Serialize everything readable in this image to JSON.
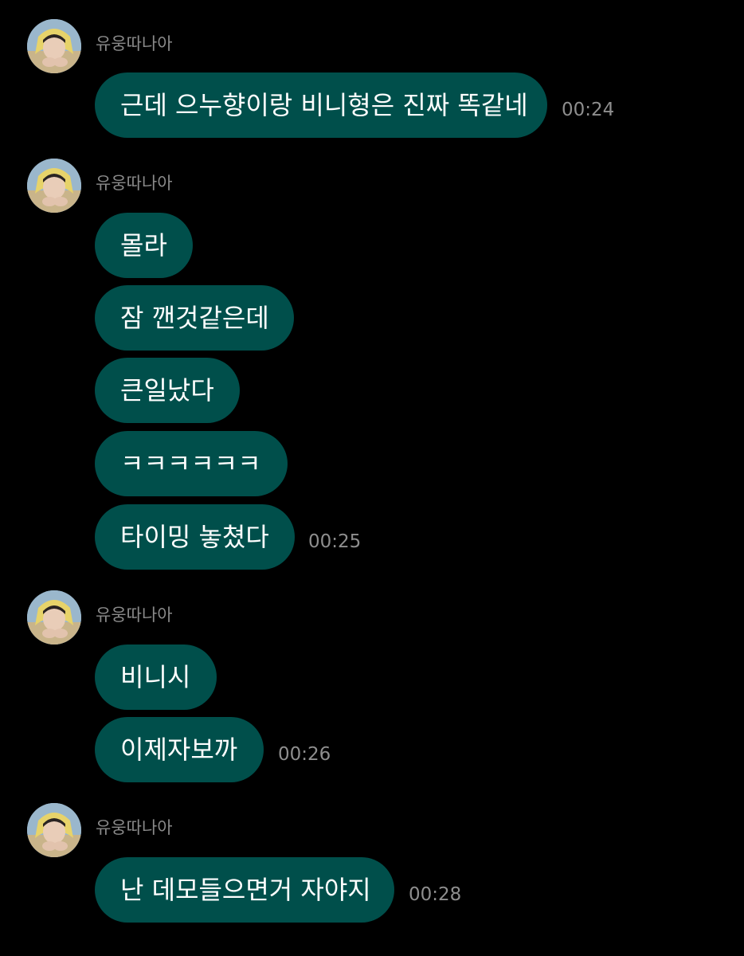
{
  "conversation": {
    "groups": [
      {
        "sender": "유웅따나아",
        "messages": [
          {
            "text": "근데 으누향이랑 비니형은 진짜 똑같네",
            "time": "00:24"
          }
        ]
      },
      {
        "sender": "유웅따나아",
        "messages": [
          {
            "text": "몰라",
            "time": ""
          },
          {
            "text": "잠 깬것같은데",
            "time": ""
          },
          {
            "text": "큰일났다",
            "time": ""
          },
          {
            "text": "ㅋㅋㅋㅋㅋㅋ",
            "time": ""
          },
          {
            "text": "타이밍 놓쳤다",
            "time": "00:25"
          }
        ]
      },
      {
        "sender": "유웅따나아",
        "messages": [
          {
            "text": "비니시",
            "time": ""
          },
          {
            "text": "이제자보까",
            "time": "00:26"
          }
        ]
      },
      {
        "sender": "유웅따나아",
        "messages": [
          {
            "text": "난 데모들으면거 자야지",
            "time": "00:28"
          }
        ]
      }
    ]
  },
  "colors": {
    "background": "#000000",
    "bubble": "#004f4b",
    "bubble_text": "#ffffff",
    "sender_text": "#8a8a8a",
    "time_text": "#8e8e8e"
  },
  "icons": {
    "avatar": "profile-photo-avatar"
  }
}
